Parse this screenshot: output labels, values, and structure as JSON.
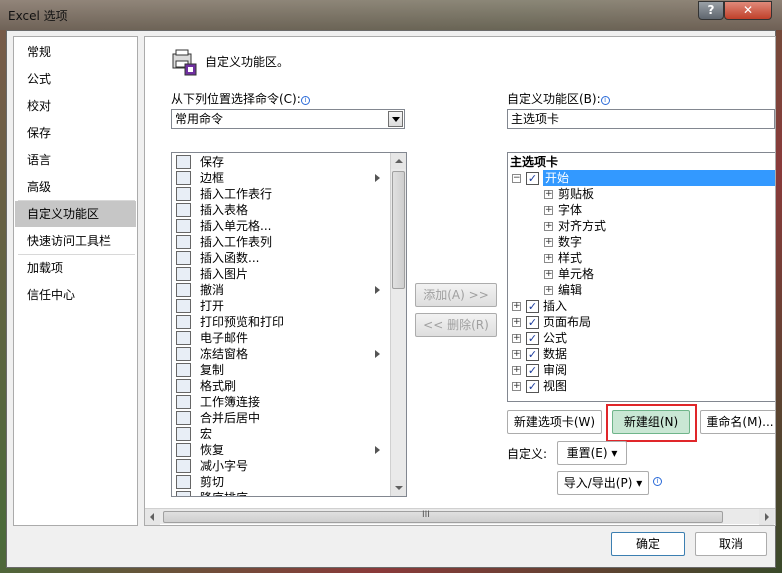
{
  "window": {
    "title": "Excel 选项",
    "help_glyph": "?",
    "close_glyph": "✕"
  },
  "nav": {
    "items": [
      "常规",
      "公式",
      "校对",
      "保存",
      "语言",
      "高级",
      "自定义功能区",
      "快速访问工具栏",
      "加载项",
      "信任中心"
    ],
    "selected": "自定义功能区"
  },
  "main": {
    "heading": "自定义功能区。",
    "left_label": "从下列位置选择命令(C):",
    "left_combo_value": "常用命令",
    "right_label": "自定义功能区(B):",
    "right_combo_value": "主选项卡",
    "commands": [
      {
        "label": "保存",
        "submenu": false
      },
      {
        "label": "边框",
        "submenu": true
      },
      {
        "label": "插入工作表行",
        "submenu": false
      },
      {
        "label": "插入表格",
        "submenu": false
      },
      {
        "label": "插入单元格...",
        "submenu": false
      },
      {
        "label": "插入工作表列",
        "submenu": false
      },
      {
        "label": "插入函数...",
        "submenu": false
      },
      {
        "label": "插入图片",
        "submenu": false
      },
      {
        "label": "撤消",
        "submenu": true
      },
      {
        "label": "打开",
        "submenu": false
      },
      {
        "label": "打印预览和打印",
        "submenu": false
      },
      {
        "label": "电子邮件",
        "submenu": false
      },
      {
        "label": "冻结窗格",
        "submenu": true
      },
      {
        "label": "复制",
        "submenu": false
      },
      {
        "label": "格式刷",
        "submenu": false
      },
      {
        "label": "工作簿连接",
        "submenu": false
      },
      {
        "label": "合并后居中",
        "submenu": false
      },
      {
        "label": "宏",
        "submenu": false
      },
      {
        "label": "恢复",
        "submenu": true
      },
      {
        "label": "减小字号",
        "submenu": false
      },
      {
        "label": "剪切",
        "submenu": false
      },
      {
        "label": "降序排序",
        "submenu": false
      }
    ],
    "add_button": "添加(A) >>",
    "remove_button": "<< 删除(R)",
    "tree_header": "主选项卡",
    "tree": [
      {
        "label": "开始",
        "level": 1,
        "expander": "−",
        "checkbox": true,
        "selected": true
      },
      {
        "label": "剪贴板",
        "level": 2,
        "expander": "+"
      },
      {
        "label": "字体",
        "level": 2,
        "expander": "+"
      },
      {
        "label": "对齐方式",
        "level": 2,
        "expander": "+"
      },
      {
        "label": "数字",
        "level": 2,
        "expander": "+"
      },
      {
        "label": "样式",
        "level": 2,
        "expander": "+"
      },
      {
        "label": "单元格",
        "level": 2,
        "expander": "+"
      },
      {
        "label": "编辑",
        "level": 2,
        "expander": "+"
      },
      {
        "label": "插入",
        "level": 1,
        "expander": "+",
        "checkbox": true
      },
      {
        "label": "页面布局",
        "level": 1,
        "expander": "+",
        "checkbox": true
      },
      {
        "label": "公式",
        "level": 1,
        "expander": "+",
        "checkbox": true
      },
      {
        "label": "数据",
        "level": 1,
        "expander": "+",
        "checkbox": true
      },
      {
        "label": "审阅",
        "level": 1,
        "expander": "+",
        "checkbox": true
      },
      {
        "label": "视图",
        "level": 1,
        "expander": "+",
        "checkbox": true
      }
    ],
    "new_tab_button": "新建选项卡(W)",
    "new_group_button": "新建组(N)",
    "rename_button": "重命名(M)...",
    "customize_label": "自定义:",
    "reset_button": "重置(E)",
    "import_export_button": "导入/导出(P)",
    "hscroll_grip": "III"
  },
  "footer": {
    "ok_button": "确定",
    "cancel_button": "取消"
  },
  "colors": {
    "highlight_box": "#e0262a",
    "tree_selected": "#3399ff",
    "new_group_bg": "#c9e7d4"
  }
}
